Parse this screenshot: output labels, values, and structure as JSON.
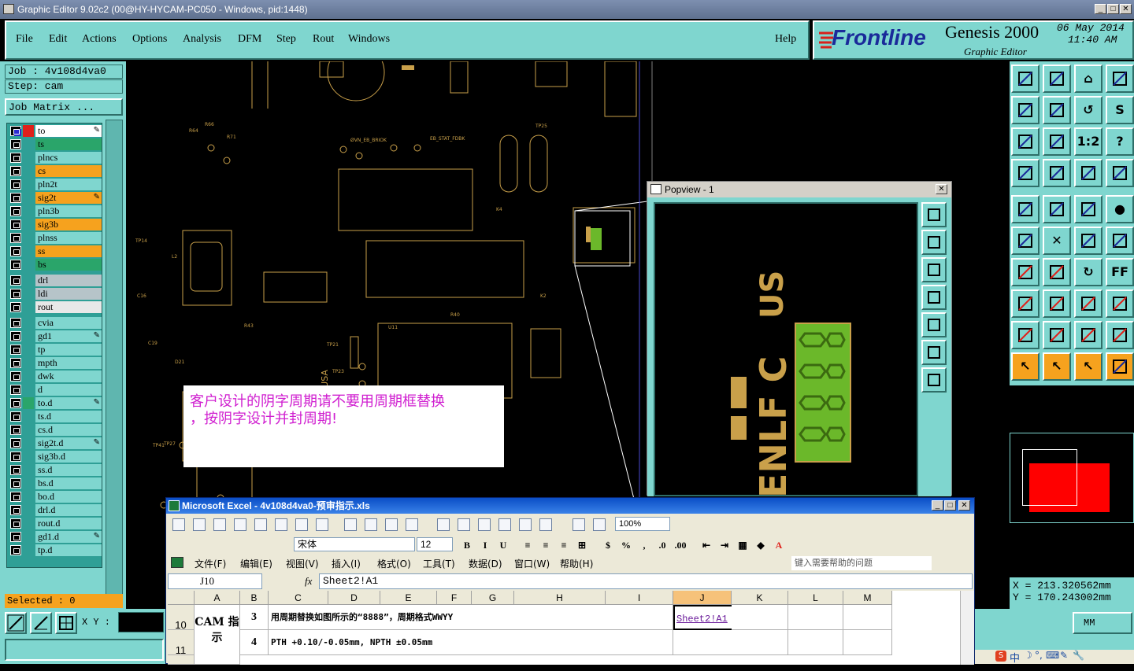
{
  "window": {
    "title": "Graphic Editor 9.02c2 (00@HY-HYCAM-PC050 - Windows, pid:1448)"
  },
  "menu": {
    "items": [
      "File",
      "Edit",
      "Actions",
      "Options",
      "Analysis",
      "DFM",
      "Step",
      "Rout",
      "Windows"
    ],
    "help": "Help"
  },
  "brand": {
    "logo": "Frontline",
    "product": "Genesis 2000",
    "subtitle": "Graphic Editor",
    "date": "06 May 2014",
    "time": "11:40 AM"
  },
  "job": {
    "label": "Job : 4v108d4va0",
    "step": "Step: cam",
    "matrix_button": "Job Matrix ..."
  },
  "layers": [
    {
      "name": "to",
      "color": "#ffffff",
      "active": true,
      "icon": true
    },
    {
      "name": "ts",
      "color": "#2aa56a"
    },
    {
      "name": "plncs",
      "color": "#7fd6cf"
    },
    {
      "name": "cs",
      "color": "#f6a21e"
    },
    {
      "name": "pln2t",
      "color": "#7fd6cf"
    },
    {
      "name": "sig2t",
      "color": "#f6a21e",
      "icon": true
    },
    {
      "name": "pln3b",
      "color": "#7fd6cf"
    },
    {
      "name": "sig3b",
      "color": "#f6a21e"
    },
    {
      "name": "plnss",
      "color": "#7fd6cf"
    },
    {
      "name": "ss",
      "color": "#f6a21e"
    },
    {
      "name": "bs",
      "color": "#2aa56a"
    },
    {
      "name": "drl",
      "color": "#b6c4c9"
    },
    {
      "name": "ldi",
      "color": "#b6c4c9"
    },
    {
      "name": "rout",
      "color": "#e8e8e8"
    },
    {
      "name": "cvia",
      "color": "#7fd6cf"
    },
    {
      "name": "gd1",
      "color": "#7fd6cf",
      "icon": true
    },
    {
      "name": "tp",
      "color": "#7fd6cf"
    },
    {
      "name": "mpth",
      "color": "#7fd6cf"
    },
    {
      "name": "dwk",
      "color": "#7fd6cf"
    },
    {
      "name": "d",
      "color": "#7fd6cf"
    },
    {
      "name": "to.d",
      "color": "#7fd6cf",
      "icon": true
    },
    {
      "name": "ts.d",
      "color": "#7fd6cf"
    },
    {
      "name": "cs.d",
      "color": "#7fd6cf"
    },
    {
      "name": "sig2t.d",
      "color": "#7fd6cf",
      "icon": true
    },
    {
      "name": "sig3b.d",
      "color": "#7fd6cf"
    },
    {
      "name": "ss.d",
      "color": "#7fd6cf"
    },
    {
      "name": "bs.d",
      "color": "#7fd6cf"
    },
    {
      "name": "bo.d",
      "color": "#7fd6cf"
    },
    {
      "name": "drl.d",
      "color": "#7fd6cf"
    },
    {
      "name": "rout.d",
      "color": "#7fd6cf"
    },
    {
      "name": "gd1.d",
      "color": "#7fd6cf",
      "icon": true
    },
    {
      "name": "tp.d",
      "color": "#7fd6cf"
    }
  ],
  "status": {
    "selected": "Selected : 0",
    "xy_label": "X Y :",
    "units": "MM"
  },
  "coords": {
    "x": "X  = 213.320562mm",
    "y": "Y  = 170.243002mm"
  },
  "note": {
    "line1": "客户设计的阴字周期请不要用周期框替换",
    "line2": "，按阴字设计并封周期!"
  },
  "popview": {
    "title": "Popview - 1",
    "text_ul": "US",
    "text_main": "ENLF C"
  },
  "excel": {
    "title": "Microsoft Excel - 4v108d4va0-预审指示.xls",
    "menu": [
      "文件(F)",
      "编辑(E)",
      "视图(V)",
      "插入(I)",
      "格式(O)",
      "工具(T)",
      "数据(D)",
      "窗口(W)",
      "帮助(H)"
    ],
    "help_placeholder": "键入需要帮助的问题",
    "zoom": "100%",
    "font": "宋体",
    "font_size": "12",
    "namebox": "J10",
    "formula": "Sheet2!A1",
    "columns": [
      "A",
      "B",
      "C",
      "D",
      "E",
      "F",
      "G",
      "H",
      "I",
      "J",
      "K",
      "L",
      "M"
    ],
    "rows": [
      {
        "num": "10",
        "b": "3",
        "c": "用周期替换如图所示的“8888”，周期格式WWYY",
        "j": "Sheet2!A1"
      },
      {
        "num": "11",
        "b": "4",
        "c": "PTH +0.10/-0.05mm, NPTH ±0.05mm",
        "j": ""
      }
    ],
    "merged_a": "CAM 指示"
  },
  "tray": [
    "中",
    "☽",
    "°,",
    "⌨",
    "✎",
    "🔧"
  ],
  "colors": {
    "panel": "#7fd6cf",
    "accent": "#f6a21e",
    "trace": "#c9a04a",
    "note_text": "#d020d0"
  }
}
